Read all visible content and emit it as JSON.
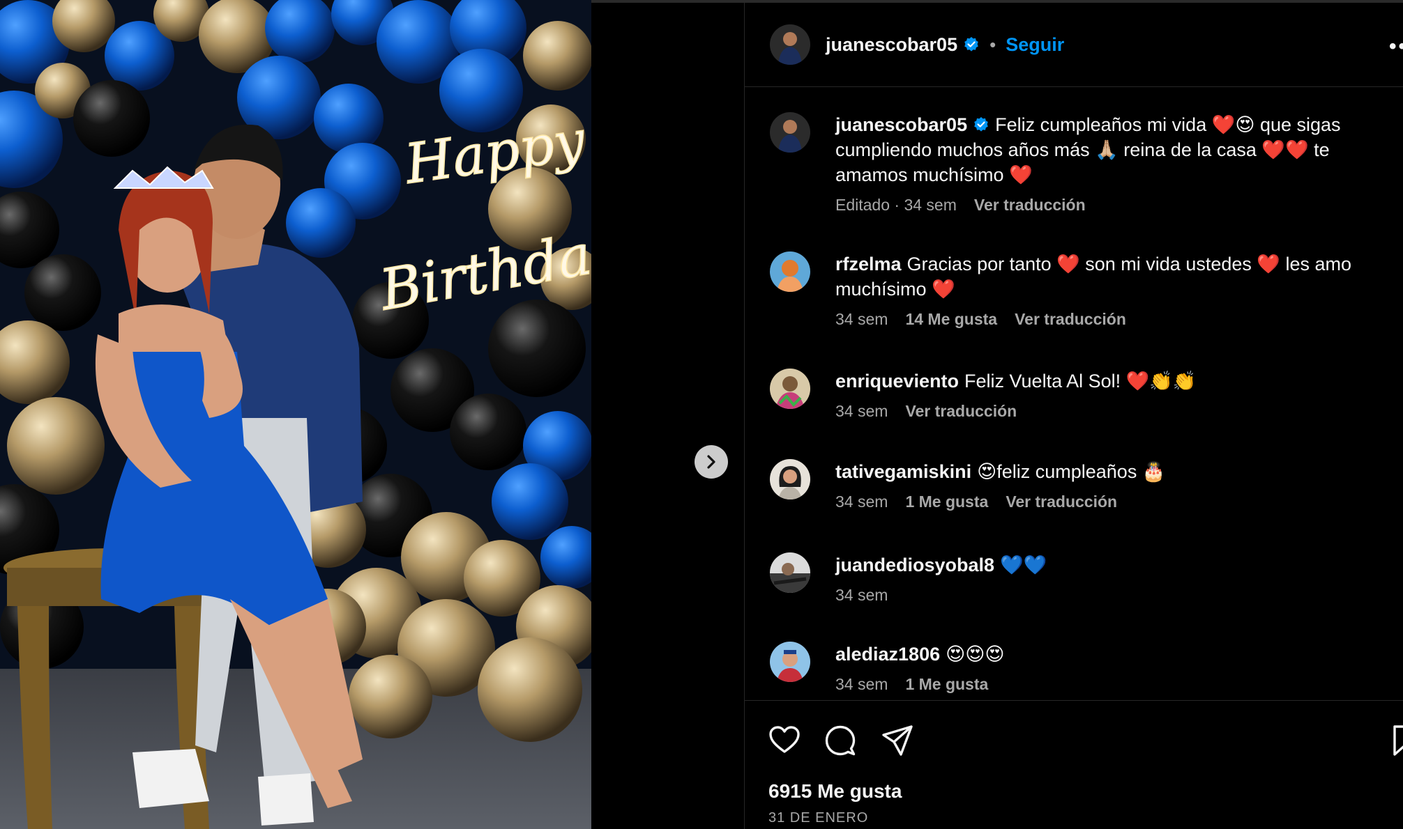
{
  "post": {
    "author": "juanescobar05",
    "follow_label": "Seguir",
    "separator": "•",
    "more_label": "••",
    "likes_text": "6915 Me gusta",
    "date_text": "31 DE ENERO",
    "photo_text": {
      "line1": "Happy",
      "line2": "Birthday"
    }
  },
  "caption": {
    "username": "juanescobar05",
    "text": "Feliz cumpleaños mi vida ❤️😍 que sigas cumpliendo muchos años más 🙏🏼 reina de la casa ❤️❤️ te amamos muchísimo ❤️",
    "meta_edited": "Editado · 34 sem",
    "translate": "Ver traducción"
  },
  "comments": [
    {
      "username": "rfzelma",
      "text": "Gracias por tanto ❤️ son mi vida ustedes ❤️ les amo muchísimo ❤️",
      "time": "34 sem",
      "likes": "14 Me gusta",
      "translate": "Ver traducción",
      "avatar_color": "#e07a2e"
    },
    {
      "username": "enriqueviento",
      "text": "Feliz Vuelta Al Sol! ❤️👏👏",
      "time": "34 sem",
      "likes": "",
      "translate": "Ver traducción",
      "avatar_color": "#7b5a3a"
    },
    {
      "username": "tativegamiskini",
      "text": "😍feliz cumpleaños 🎂",
      "time": "34 sem",
      "likes": "1 Me gusta",
      "translate": "Ver traducción",
      "avatar_color": "#d9d2c8"
    },
    {
      "username": "juandediosyobal8",
      "text": "💙💙",
      "time": "34 sem",
      "likes": "",
      "translate": "",
      "avatar_color": "#5a5a5a"
    },
    {
      "username": "alediaz1806",
      "text": "😍😍😍",
      "time": "34 sem",
      "likes": "1 Me gusta",
      "translate": "",
      "avatar_color": "#3c6fa8"
    }
  ],
  "colors": {
    "accent_blue": "#0095f6",
    "text_primary": "#f5f5f5",
    "text_secondary": "#a8a8a8",
    "background": "#000000",
    "divider": "#262626"
  },
  "icons": [
    "verified-badge-icon",
    "heart-icon",
    "comment-icon",
    "share-icon",
    "bookmark-icon",
    "chevron-right-icon",
    "more-options-icon"
  ]
}
